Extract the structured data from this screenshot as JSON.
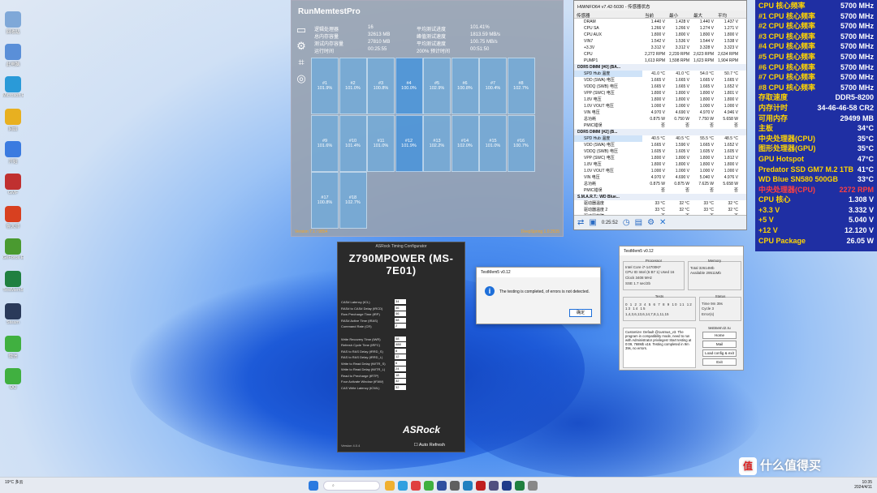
{
  "desktop": {
    "icons": [
      {
        "label": "回收站",
        "color": "#7fa8d8"
      },
      {
        "label": "此电脑",
        "color": "#5a8fd8"
      },
      {
        "label": "Microsoft Edge",
        "color": "#2a9ad8"
      },
      {
        "label": "网络",
        "color": "#e8b020"
      },
      {
        "label": "开始",
        "color": "#3b7be0"
      },
      {
        "label": "GMF",
        "color": "#c03030"
      },
      {
        "label": "鲁大师",
        "color": "#d84020"
      },
      {
        "label": "GeForce Experience",
        "color": "#4a9a30"
      },
      {
        "label": "TestMem5",
        "color": "#208040"
      },
      {
        "label": "Steam",
        "color": "#2a3a5a"
      },
      {
        "label": "微信",
        "color": "#40b040"
      },
      {
        "label": "QQ",
        "color": "#40b040"
      }
    ]
  },
  "runmemtest": {
    "title": "RunMemtestPro",
    "stats": [
      {
        "k": "逻辑处理器",
        "v": "16"
      },
      {
        "k": "总内存容量",
        "v": "32613 MB"
      },
      {
        "k": "测试内存容量",
        "v": "27810 MB"
      },
      {
        "k": "运行时间",
        "v": "00:25:55"
      },
      {
        "k": "平均测试进度",
        "v": "101.41%"
      },
      {
        "k": "峰值测试速度",
        "v": "1813.59 MB/s"
      },
      {
        "k": "平均测试速度",
        "v": "100.75 MB/s"
      },
      {
        "k": "200% 预计时间",
        "v": "00:51:50"
      }
    ],
    "threads": [
      {
        "id": "#1",
        "pct": "101.9%"
      },
      {
        "id": "#2",
        "pct": "101.0%"
      },
      {
        "id": "#3",
        "pct": "100.8%"
      },
      {
        "id": "#4",
        "pct": "100.0%"
      },
      {
        "id": "#5",
        "pct": "102.9%"
      },
      {
        "id": "#6",
        "pct": "100.8%"
      },
      {
        "id": "#7",
        "pct": "100.4%"
      },
      {
        "id": "#8",
        "pct": "102.7%"
      },
      {
        "id": "#9",
        "pct": "101.6%"
      },
      {
        "id": "#10",
        "pct": "101.4%"
      },
      {
        "id": "#11",
        "pct": "101.0%"
      },
      {
        "id": "#12",
        "pct": "101.9%"
      },
      {
        "id": "#13",
        "pct": "102.2%"
      },
      {
        "id": "#14",
        "pct": "102.0%"
      },
      {
        "id": "#15",
        "pct": "101.0%"
      },
      {
        "id": "#16",
        "pct": "100.7%"
      },
      {
        "id": "#17",
        "pct": "100.8%"
      },
      {
        "id": "#18",
        "pct": "102.7%"
      }
    ],
    "footer_left": "Version 7.1 / 9854",
    "footer_right": "DeepSpring 1.0.2535"
  },
  "hwinfo": {
    "title": "HWiNFO64 v7.42-5030 - 传感器状态",
    "columns": [
      "传感器",
      "当前",
      "最小",
      "最大",
      "平均"
    ],
    "rows": [
      {
        "t": "r",
        "n": "DRAM",
        "c": [
          "1.440 V",
          "1.428 V",
          "1.440 V",
          "1.437 V"
        ]
      },
      {
        "t": "r",
        "n": "CPU SA",
        "c": [
          "1.266 V",
          "1.266 V",
          "1.274 V",
          "1.271 V"
        ]
      },
      {
        "t": "r",
        "n": "CPU AUX",
        "c": [
          "1.800 V",
          "1.800 V",
          "1.800 V",
          "1.800 V"
        ]
      },
      {
        "t": "r",
        "n": "VIN7",
        "c": [
          "1.542 V",
          "1.536 V",
          "1.544 V",
          "1.538 V"
        ]
      },
      {
        "t": "r",
        "n": "+3.3V",
        "c": [
          "3.312 V",
          "3.312 V",
          "3.328 V",
          "3.323 V"
        ]
      },
      {
        "t": "r",
        "n": "CPU",
        "c": [
          "2,272 RPM",
          "2,239 RPM",
          "2,623 RPM",
          "2,634 RPM"
        ]
      },
      {
        "t": "r",
        "n": "PUMP1",
        "c": [
          "1,613 RPM",
          "1,598 RPM",
          "1,623 RPM",
          "1,904 RPM"
        ]
      },
      {
        "t": "s",
        "n": "DDR5 DIMM [#0] (BA..."
      },
      {
        "t": "r",
        "n": "SPD Hub 温度",
        "c": [
          "41.0 °C",
          "41.0 °C",
          "54.0 °C",
          "50.7 °C"
        ],
        "sel": true
      },
      {
        "t": "r",
        "n": "VDD (SWA) 电压",
        "c": [
          "1.665 V",
          "1.665 V",
          "1.665 V",
          "1.665 V"
        ]
      },
      {
        "t": "r",
        "n": "VDDQ (SWB) 电压",
        "c": [
          "1.665 V",
          "1.665 V",
          "1.665 V",
          "1.652 V"
        ]
      },
      {
        "t": "r",
        "n": "VPP (SWC) 电压",
        "c": [
          "1.800 V",
          "1.800 V",
          "1.800 V",
          "1.801 V"
        ]
      },
      {
        "t": "r",
        "n": "1.8V 电压",
        "c": [
          "1.800 V",
          "1.800 V",
          "1.800 V",
          "1.800 V"
        ]
      },
      {
        "t": "r",
        "n": "1.0V VOUT 电压",
        "c": [
          "1.000 V",
          "1.000 V",
          "1.000 V",
          "1.000 V"
        ]
      },
      {
        "t": "r",
        "n": "VIN 电压",
        "c": [
          "4.970 V",
          "4.690 V",
          "4.970 V",
          "4.946 V"
        ]
      },
      {
        "t": "r",
        "n": "总功耗",
        "c": [
          "0.875 W",
          "0.750 W",
          "7.750 W",
          "5.658 W"
        ]
      },
      {
        "t": "r",
        "n": "PMIC错误",
        "c": [
          "否",
          "否",
          "否",
          "否"
        ]
      },
      {
        "t": "s",
        "n": "DDR5 DIMM [#2] (B..."
      },
      {
        "t": "r",
        "n": "SPD Hub 温度",
        "c": [
          "40.5 °C",
          "40.5 °C",
          "55.5 °C",
          "48.5 °C"
        ],
        "sel": true
      },
      {
        "t": "r",
        "n": "VDD (SWA) 电压",
        "c": [
          "1.665 V",
          "1.590 V",
          "1.665 V",
          "1.652 V"
        ]
      },
      {
        "t": "r",
        "n": "VDDQ (SWB) 电压",
        "c": [
          "1.605 V",
          "1.605 V",
          "1.605 V",
          "1.605 V"
        ]
      },
      {
        "t": "r",
        "n": "VPP (SWC) 电压",
        "c": [
          "1.800 V",
          "1.800 V",
          "1.800 V",
          "1.812 V"
        ]
      },
      {
        "t": "r",
        "n": "1.8V 电压",
        "c": [
          "1.800 V",
          "1.800 V",
          "1.800 V",
          "1.800 V"
        ]
      },
      {
        "t": "r",
        "n": "1.0V VOUT 电压",
        "c": [
          "1.000 V",
          "1.000 V",
          "1.000 V",
          "1.000 V"
        ]
      },
      {
        "t": "r",
        "n": "VIN 电压",
        "c": [
          "4.970 V",
          "4.690 V",
          "5.040 V",
          "4.976 V"
        ]
      },
      {
        "t": "r",
        "n": "总功耗",
        "c": [
          "0.875 W",
          "0.875 W",
          "7.625 W",
          "5.658 W"
        ]
      },
      {
        "t": "r",
        "n": "PMIC错误",
        "c": [
          "否",
          "否",
          "否",
          "否"
        ]
      },
      {
        "t": "s",
        "n": "S.M.A.R.T.: WD Blue..."
      },
      {
        "t": "r",
        "n": "驱动器温度",
        "c": [
          "33 °C",
          "32 °C",
          "33 °C",
          "32 °C"
        ]
      },
      {
        "t": "r",
        "n": "驱动器温度 2",
        "c": [
          "33 °C",
          "32 °C",
          "33 °C",
          "32 °C"
        ]
      },
      {
        "t": "r",
        "n": "驱动器故障",
        "c": [
          "否",
          "否",
          "否",
          "否"
        ]
      }
    ],
    "elapsed": "0:25:52"
  },
  "osd": [
    {
      "l": "CPU 核心频率",
      "r": "5700 MHz"
    },
    {
      "l": "#1 CPU 核心频率",
      "r": "5700 MHz"
    },
    {
      "l": "#2 CPU 核心频率",
      "r": "5700 MHz"
    },
    {
      "l": "#3 CPU 核心频率",
      "r": "5700 MHz"
    },
    {
      "l": "#4 CPU 核心频率",
      "r": "5700 MHz"
    },
    {
      "l": "#5 CPU 核心频率",
      "r": "5700 MHz"
    },
    {
      "l": "#6 CPU 核心频率",
      "r": "5700 MHz"
    },
    {
      "l": "#7 CPU 核心频率",
      "r": "5700 MHz"
    },
    {
      "l": "#8 CPU 核心频率",
      "r": "5700 MHz"
    },
    {
      "l": "存取速度",
      "r": "DDR5-8200"
    },
    {
      "l": "内存计时",
      "r": "34-46-46-58 CR2"
    },
    {
      "l": "可用内存",
      "r": "29499 MB"
    },
    {
      "l": "主板",
      "r": "34°C"
    },
    {
      "l": "中央处理器(CPU)",
      "r": "35°C"
    },
    {
      "l": "图形处理器(GPU)",
      "r": "35°C"
    },
    {
      "l": "GPU Hotspot",
      "r": "47°C"
    },
    {
      "l": "Predator SSD GM7 M.2 1TB",
      "r": "41°C"
    },
    {
      "l": "WD Blue SN580 500GB",
      "r": "33°C"
    },
    {
      "l": "中央处理器(CPU)",
      "r": "2272 RPM",
      "red": true
    },
    {
      "l": "CPU 核心",
      "r": "1.308 V"
    },
    {
      "l": "+3.3 V",
      "r": "3.332 V"
    },
    {
      "l": "+5 V",
      "r": "5.040 V"
    },
    {
      "l": "+12 V",
      "r": "12.120 V"
    },
    {
      "l": "CPU Package",
      "r": "26.05 W"
    }
  ],
  "timing": {
    "header": "ASRock Timing Configurator",
    "board": "Z790MPOWER (MS-7E01)",
    "rows_left": [
      {
        "k": "CAS# Latency (tCL)",
        "v": "34"
      },
      {
        "k": "RAS# to CAS# Delay (tRCD)",
        "v": "46"
      },
      {
        "k": "Row Precharge Time (tRP)",
        "v": "46"
      },
      {
        "k": "RAS# Active Time (tRAS)",
        "v": "58"
      },
      {
        "k": "Command Rate (CR)",
        "v": "2"
      },
      {
        "k": "Write Recovery Time (tWR)",
        "v": "48"
      },
      {
        "k": "Refresh Cycle Time (tRFC)",
        "v": "488"
      },
      {
        "k": "RAS to RAS Delay (tRRD_S)",
        "v": "8"
      },
      {
        "k": "RAS to RAS Delay (tRRD_L)",
        "v": "12"
      },
      {
        "k": "Write to Read Delay (tWTR_S)",
        "v": "6"
      },
      {
        "k": "Write to Read Delay (tWTR_L)",
        "v": "24"
      },
      {
        "k": "Read to Precharge (tRTP)",
        "v": "18"
      },
      {
        "k": "Four Activate Window (tFAW)",
        "v": "32"
      },
      {
        "k": "CAS Write Latency (tCWL)",
        "v": "32"
      }
    ],
    "brand": "ASRock",
    "auto_refresh": "Auto Refresh",
    "version": "Version 4.0.4"
  },
  "dialog": {
    "title": "TestMem5 v0.12",
    "message": "The testing is completed, of errors is not detected.",
    "ok": "确定"
  },
  "testmem": {
    "title": "TestMem5 v0.12",
    "processor_cap": "Processor",
    "cpu": "Intel Core i7-14700KF",
    "cpu_id": "Intel (6 B7 1)",
    "threads_label": "Used",
    "threads": "16",
    "clock": "3408 MHz",
    "sse": "1.7 sec/2b",
    "memory_cap": "Memory",
    "total": "32614Mb",
    "available": "29511Mb",
    "tests_cap": "Tests",
    "tests_seq": "1,4,3,6,13,6,14,7,8,1,11,15",
    "status_cap": "Status",
    "time": "9m 39s",
    "cycle": "3",
    "errors": "",
    "log": "Customize: Default @1usmus_v3. The program in compatibility mode, need to run with Administrator privileges! Start testing at 0:09, 768Mb x16. Testing completed in 9m 39s, no errors.",
    "site": "testmem.tz.ru",
    "buttons": [
      "Home",
      "Mail",
      "Load config & exit",
      "Exit"
    ]
  },
  "taskbar": {
    "weather": "19°C 多云",
    "time": "10:35",
    "date": "2024/4/11"
  },
  "watermark": "什么值得买"
}
